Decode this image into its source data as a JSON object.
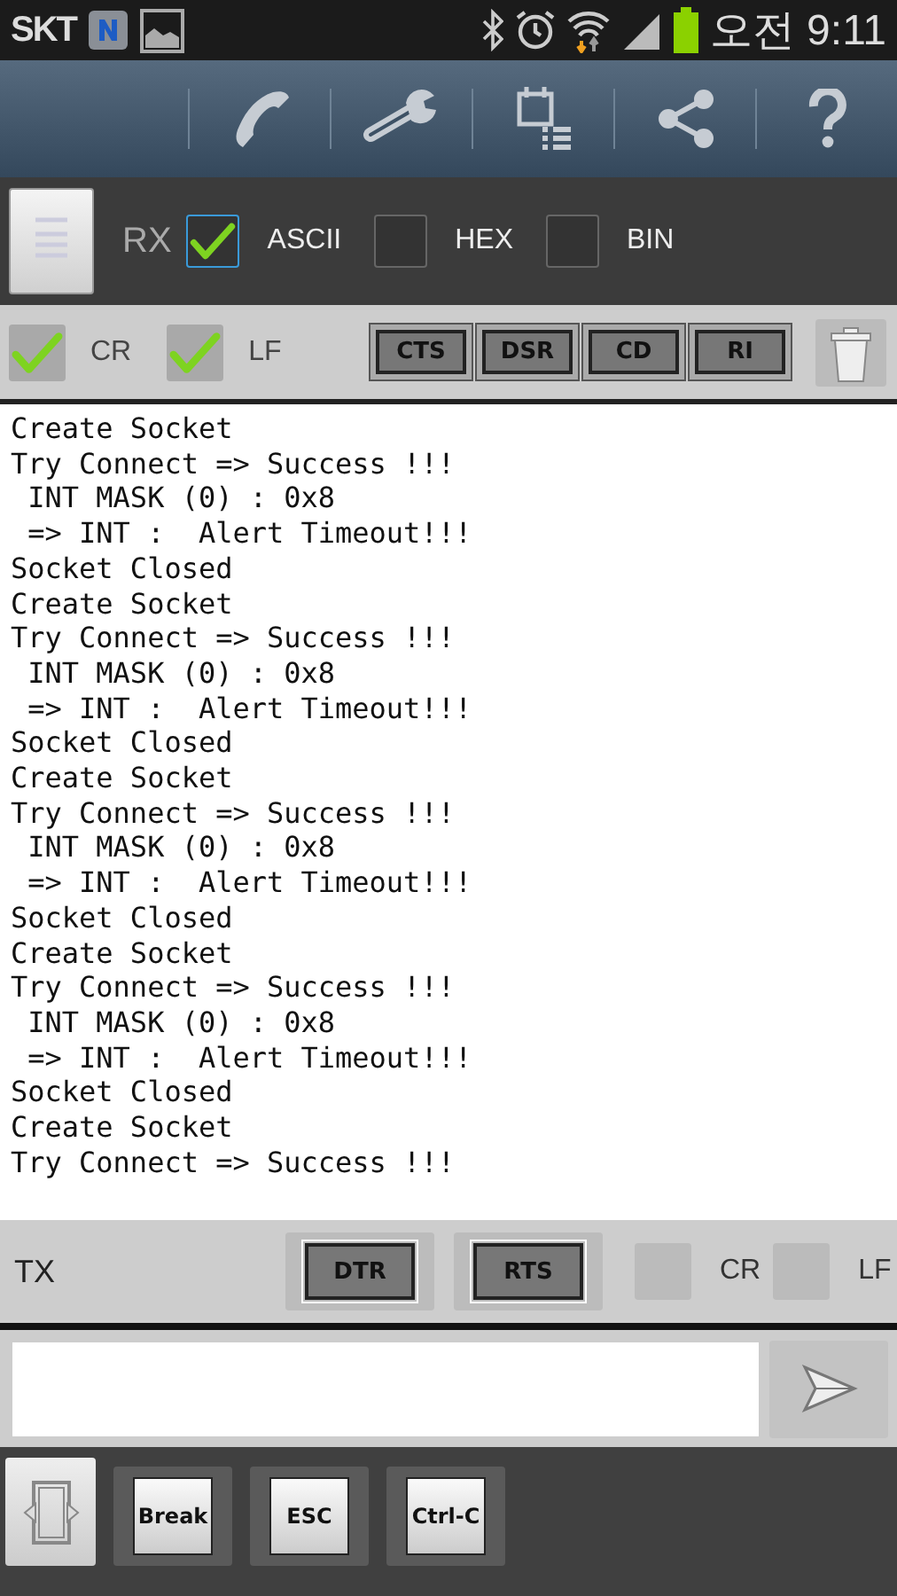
{
  "status_bar": {
    "carrier": "SKT",
    "time": "오전 9:11"
  },
  "rx": {
    "label": "RX",
    "modes": [
      {
        "label": "ASCII",
        "checked": true
      },
      {
        "label": "HEX",
        "checked": false
      },
      {
        "label": "BIN",
        "checked": false
      }
    ]
  },
  "rx_line_end": [
    {
      "label": "CR",
      "checked": true
    },
    {
      "label": "LF",
      "checked": true
    }
  ],
  "signals": [
    "CTS",
    "DSR",
    "CD",
    "RI"
  ],
  "terminal": {
    "lines": [
      "Create Socket",
      "Try Connect => Success !!!",
      " INT MASK (0) : 0x8",
      " => INT :  Alert Timeout!!!",
      "Socket Closed",
      "Create Socket",
      "Try Connect => Success !!!",
      " INT MASK (0) : 0x8",
      " => INT :  Alert Timeout!!!",
      "Socket Closed",
      "Create Socket",
      "Try Connect => Success !!!",
      " INT MASK (0) : 0x8",
      " => INT :  Alert Timeout!!!",
      "Socket Closed",
      "Create Socket",
      "Try Connect => Success !!!",
      " INT MASK (0) : 0x8",
      " => INT :  Alert Timeout!!!",
      "Socket Closed",
      "Create Socket",
      "Try Connect => Success !!!"
    ]
  },
  "tx": {
    "label": "TX",
    "buttons": [
      "DTR",
      "RTS"
    ],
    "line_end": [
      {
        "label": "CR",
        "checked": false
      },
      {
        "label": "LF",
        "checked": false
      }
    ]
  },
  "keys": [
    "Break",
    "ESC",
    "Ctrl-C"
  ]
}
